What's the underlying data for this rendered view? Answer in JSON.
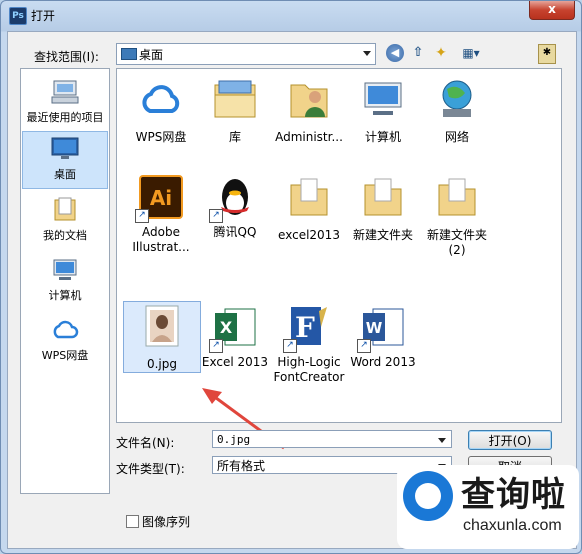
{
  "window": {
    "title": "打开",
    "app_icon": "Ps",
    "close_label": "x"
  },
  "toolbar": {
    "look_in_label": "查找范围(I):",
    "look_in_value": "桌面",
    "back_icon": "back-icon",
    "up_icon": "up-folder-icon",
    "new_folder_icon": "new-folder-icon",
    "views_icon": "views-menu-icon"
  },
  "places": [
    {
      "label": "最近使用的项目",
      "icon": "recent-items-icon"
    },
    {
      "label": "桌面",
      "icon": "desktop-icon",
      "active": true
    },
    {
      "label": "我的文档",
      "icon": "documents-icon"
    },
    {
      "label": "计算机",
      "icon": "computer-icon"
    },
    {
      "label": "WPS网盘",
      "icon": "wps-cloud-icon"
    }
  ],
  "files": [
    {
      "label": "WPS网盘",
      "icon": "wps-cloud-icon"
    },
    {
      "label": "库",
      "icon": "library-icon"
    },
    {
      "label": "Administr...",
      "icon": "user-folder-icon"
    },
    {
      "label": "计算机",
      "icon": "computer-icon"
    },
    {
      "label": "网络",
      "icon": "network-icon"
    },
    {
      "label": "Adobe Illustrat...",
      "icon": "illustrator-icon"
    },
    {
      "label": "腾讯QQ",
      "icon": "qq-icon"
    },
    {
      "label": "excel2013",
      "icon": "folder-icon"
    },
    {
      "label": "新建文件夹",
      "icon": "folder-icon"
    },
    {
      "label": "新建文件夹 (2)",
      "icon": "folder-icon"
    },
    {
      "label": "0.jpg",
      "icon": "image-file-icon",
      "selected": true
    },
    {
      "label": "Excel 2013",
      "icon": "excel-icon"
    },
    {
      "label": "High-Logic FontCreator",
      "icon": "fontcreator-icon"
    },
    {
      "label": "Word 2013",
      "icon": "word-icon"
    }
  ],
  "form": {
    "filename_label": "文件名(N):",
    "filename_value": "0.jpg",
    "filetype_label": "文件类型(T):",
    "filetype_value": "所有格式",
    "open_button": "打开(O)",
    "cancel_button": "取消",
    "image_sequence_label": "图像序列"
  },
  "watermark": {
    "text": "查询啦",
    "url": "chaxunla.com"
  },
  "colors": {
    "accent": "#1a78d6",
    "arrow": "#e0463c",
    "selection": "#dbeafc"
  }
}
